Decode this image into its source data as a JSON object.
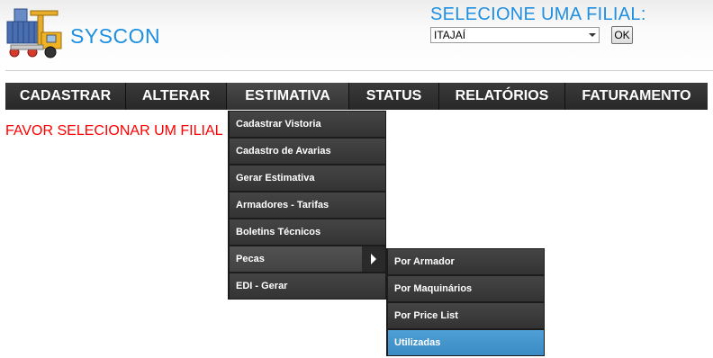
{
  "header": {
    "brand": "SYSCON",
    "logo_icon": "container-crane-icon",
    "filial_title": "SELECIONE UMA FILIAL:",
    "filial_select_value": "ITAJAÍ",
    "ok_label": "OK"
  },
  "menu": {
    "items": [
      {
        "label": "CADASTRAR"
      },
      {
        "label": "ALTERAR"
      },
      {
        "label": "ESTIMATIVA",
        "active": true
      },
      {
        "label": "STATUS"
      },
      {
        "label": "RELATÓRIOS"
      },
      {
        "label": "FATURAMENTO"
      }
    ]
  },
  "warning": "FAVOR SELECIONAR UM FILIAL",
  "dropdown": {
    "items": [
      {
        "label": "Cadastrar Vistoria"
      },
      {
        "label": "Cadastro de Avarias"
      },
      {
        "label": "Gerar Estimativa"
      },
      {
        "label": "Armadores - Tarifas"
      },
      {
        "label": "Boletins Técnicos"
      },
      {
        "label": "Pecas",
        "has_submenu": true
      },
      {
        "label": "EDI - Gerar"
      }
    ]
  },
  "submenu": {
    "items": [
      {
        "label": "Por Armador"
      },
      {
        "label": "Por Maquinários"
      },
      {
        "label": "Por Price List"
      },
      {
        "label": "Utilizadas",
        "selected": true
      }
    ]
  },
  "colors": {
    "brand_blue": "#1e8fe1",
    "warning_red": "#ff0000",
    "menu_dark": "#2f2f2f",
    "selected_blue": "#4a9bd2"
  }
}
